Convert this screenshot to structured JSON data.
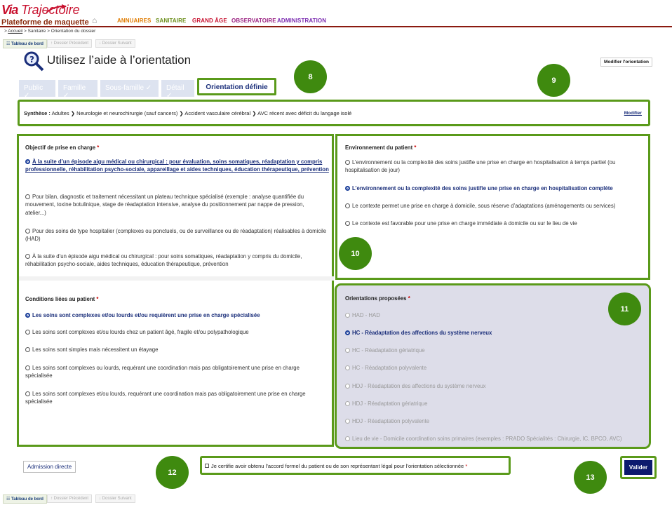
{
  "app": {
    "logo_via": "Via",
    "logo_trajectoire": "Trajectoire",
    "platform": "Plateforme de maquette"
  },
  "menu": [
    {
      "label": "ANNUAIRES",
      "color": "#e07b00"
    },
    {
      "label": "SANITAIRE",
      "color": "#6a8e1a"
    },
    {
      "label": "GRAND ÂGE",
      "color": "#c8102e"
    },
    {
      "label": "OBSERVATOIRE",
      "color": "#9a2080"
    },
    {
      "label": "ADMINISTRATION",
      "color": "#7a2ab0"
    }
  ],
  "breadcrumb": {
    "home": "Accueil",
    "sep": " > ",
    "rest": "Sanitaire > Orientation du dossier",
    "prefix": "> "
  },
  "nav": {
    "dashboard": "Tableau de bord",
    "prev": "Dossier Précédent",
    "next": "Dossier Suivant"
  },
  "page": {
    "title": "Utilisez l’aide à l’orientation",
    "modify_orientation": "Modifier l'orientation"
  },
  "tabs": [
    "Public ✓",
    "Famille ✓",
    "Sous-famille ✓",
    "Détail ✓",
    "Orientation définie"
  ],
  "synthesis": {
    "label": "Synthèse :",
    "text": "Adultes ❯ Neurologie et neurochirurgie (sauf cancers) ❯ Accident vasculaire cérébral ❯ AVC récent avec déficit du langage isolé",
    "modify": "Modifier"
  },
  "objective": {
    "title": "Objectif de prise en charge",
    "options": [
      "À la suite d’un épisode aigu médical ou chirurgical : pour évaluation, soins somatiques, réadaptation y compris professionnelle, réhabilitation psycho-sociale, appareillage et aides techniques, éducation thérapeutique, prévention",
      "Pour bilan, diagnostic et traitement nécessitant un plateau technique spécialisé (exemple : analyse quantifiée du mouvement, toxine botulinique, stage de réadaptation intensive, analyse du positionnement par nappe de pression, atelier...)",
      "Pour des soins de type hospitalier (complexes ou ponctuels, ou de surveillance ou de réadaptation) réalisables à domicile (HAD)",
      "À la suite d’un épisode aigu médical ou chirurgical : pour soins somatiques, réadaptation y compris du domicile, réhabilitation psycho-sociale, aides techniques, éducation thérapeutique, prévention"
    ]
  },
  "environment": {
    "title": "Environnement du patient",
    "options": [
      "L’environnement ou la complexité des soins justifie une prise en charge en hospitalisation à temps partiel (ou hospitalisation de jour)",
      "L’environnement ou la complexité des soins justifie une prise en charge en hospitalisation complète",
      "Le contexte permet une prise en charge à domicile, sous réserve d’adaptations (aménagements ou services)",
      "Le contexte est favorable pour une prise en charge immédiate à domicile ou sur le lieu de vie"
    ]
  },
  "conditions": {
    "title": "Conditions liées au patient",
    "options": [
      "Les soins sont complexes et/ou lourds et/ou requièrent une prise en charge spécialisée",
      "Les soins sont complexes et/ou lourds chez un patient âgé, fragile et/ou polypathologique",
      "Les soins sont simples mais nécessitent un étayage",
      "Les soins sont complexes ou lourds, requérant une coordination mais pas obligatoirement une prise en charge spécialisée",
      "Les soins sont complexes et/ou lourds, requérant une coordination mais pas obligatoirement une prise en charge spécialisée"
    ]
  },
  "orientations": {
    "title": "Orientations proposées",
    "options": [
      "HAD - HAD",
      "HC - Réadaptation des affections du système nerveux",
      "HC - Réadaptation gériatrique",
      "HC - Réadaptation polyvalente",
      "HDJ - Réadaptation des affections du système nerveux",
      "HDJ - Réadaptation gériatrique",
      "HDJ - Réadaptation polyvalente",
      "Lieu de vie - Domicile coordination soins primaires (exemples : PRADO Spécialités : Chirurgie, IC, BPCO, AVC)"
    ]
  },
  "footer": {
    "admission": "Admission directe",
    "certify": "Je certifie avoir obtenu l’accord formel du patient ou de son représentant légal pour l’orientation sélectionnée",
    "validate": "Valider"
  },
  "markers": [
    "8",
    "9",
    "10",
    "11",
    "12",
    "13"
  ],
  "colors": {
    "highlight": "#5a9a1a",
    "marker": "#3f8a0f",
    "brand": "#c8102e",
    "selected": "#1a2e7a"
  }
}
